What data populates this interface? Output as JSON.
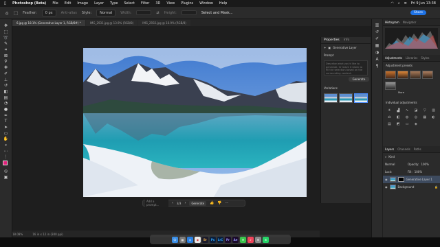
{
  "menubar": {
    "apple": "",
    "app": "Photoshop (Beta)",
    "items": [
      "File",
      "Edit",
      "Image",
      "Layer",
      "Type",
      "Select",
      "Filter",
      "3D",
      "View",
      "Plugins",
      "Window",
      "Help"
    ],
    "title": "Adobe Photoshop (Beta)",
    "datetime": "Fri 9 Jun  13:38"
  },
  "options": {
    "feather_label": "Feather:",
    "feather_value": "0 px",
    "antialias": "Anti-alias",
    "style_label": "Style:",
    "style_value": "Normal",
    "width_label": "Width:",
    "height_label": "Height:",
    "select_mask": "Select and Mask...",
    "share": "Share"
  },
  "tabs": [
    {
      "label": "6.jpg @ 18.1% (Generative Layer 1, RGB/8#) *",
      "active": true
    },
    {
      "label": "IMG_2931.jpg @ 13.9% (RGB/8)",
      "active": false
    },
    {
      "label": "IMG_2932.jpg @ 16.9% (RGB/8)",
      "active": false
    }
  ],
  "contextbar": {
    "prompt_placeholder": "Add a prompt...",
    "counter": "3/3",
    "generate": "Generate"
  },
  "status": {
    "zoom": "18.08%",
    "doc": "16 in x 12 in (300 ppi)"
  },
  "properties": {
    "tab1": "Properties",
    "tab2": "Info",
    "layer_name": "Generative Layer",
    "prompt_title": "Prompt",
    "prompt_text": "Describe what you'd like to generate. Or leave it blank to fill the selection based on the surrounding content.",
    "generate": "Generate",
    "variations_title": "Variations"
  },
  "panels": {
    "histogram_tab": "Histogram",
    "navigator_tab": "Navigator",
    "adjustments_tab": "Adjustments",
    "libraries_tab": "Libraries",
    "styles_tab": "Styles",
    "presets_title": "Adjustment presets",
    "preset_more": "More",
    "individual_title": "Individual adjustments",
    "layers_tab": "Layers",
    "channels_tab": "Channels",
    "paths_tab": "Paths",
    "kind_label": "Kind",
    "blend_mode": "Normal",
    "opacity_label": "Opacity:",
    "opacity_value": "100%",
    "lock_label": "Lock:",
    "fill_label": "Fill:",
    "fill_value": "100%",
    "layers": [
      {
        "name": "Generative Layer 1",
        "selected": true
      },
      {
        "name": "Background",
        "selected": false
      }
    ]
  },
  "dock": [
    "Finder",
    "Launchpad",
    "Safari",
    "Chrome",
    "Br",
    "Ps",
    "LrC",
    "Pr",
    "Ae",
    "Messages",
    "Music",
    "Settings",
    "WhatsApp"
  ],
  "colors": {
    "accent": "#1f73e6",
    "panel": "#2b2b2b",
    "selection": "#3d4a5e"
  }
}
